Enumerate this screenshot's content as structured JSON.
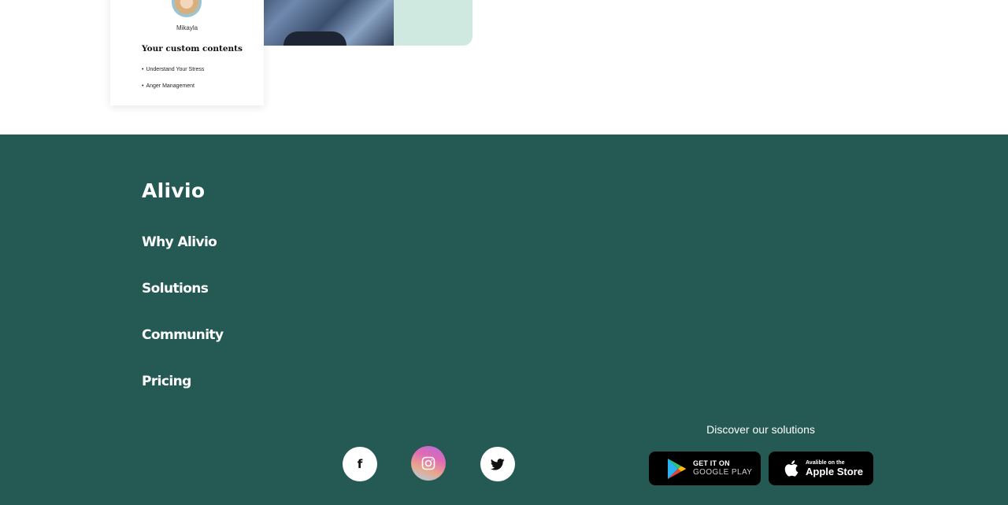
{
  "hero": {
    "card": {
      "name": "Mikayla",
      "title": "Your custom contents",
      "items": [
        "Understand Your Stress",
        "Anger Management"
      ]
    }
  },
  "footer": {
    "logo": "Alivio",
    "nav": [
      "Why Alivio",
      "Solutions",
      "Community",
      "Pricing"
    ],
    "social": {
      "facebook_glyph": "f",
      "icons": [
        "facebook-icon",
        "instagram-icon",
        "twitter-icon"
      ]
    },
    "discover": "Discover our solutions",
    "google_badge": {
      "small": "GET IT ON",
      "big": "GOOGLE PLAY"
    },
    "apple_badge": {
      "small": "Avalible on the",
      "big": "Apple Store"
    }
  },
  "colors": {
    "footer_bg": "#245954",
    "hero_accent": "#cfe9e1",
    "text_light": "#ffffff"
  }
}
